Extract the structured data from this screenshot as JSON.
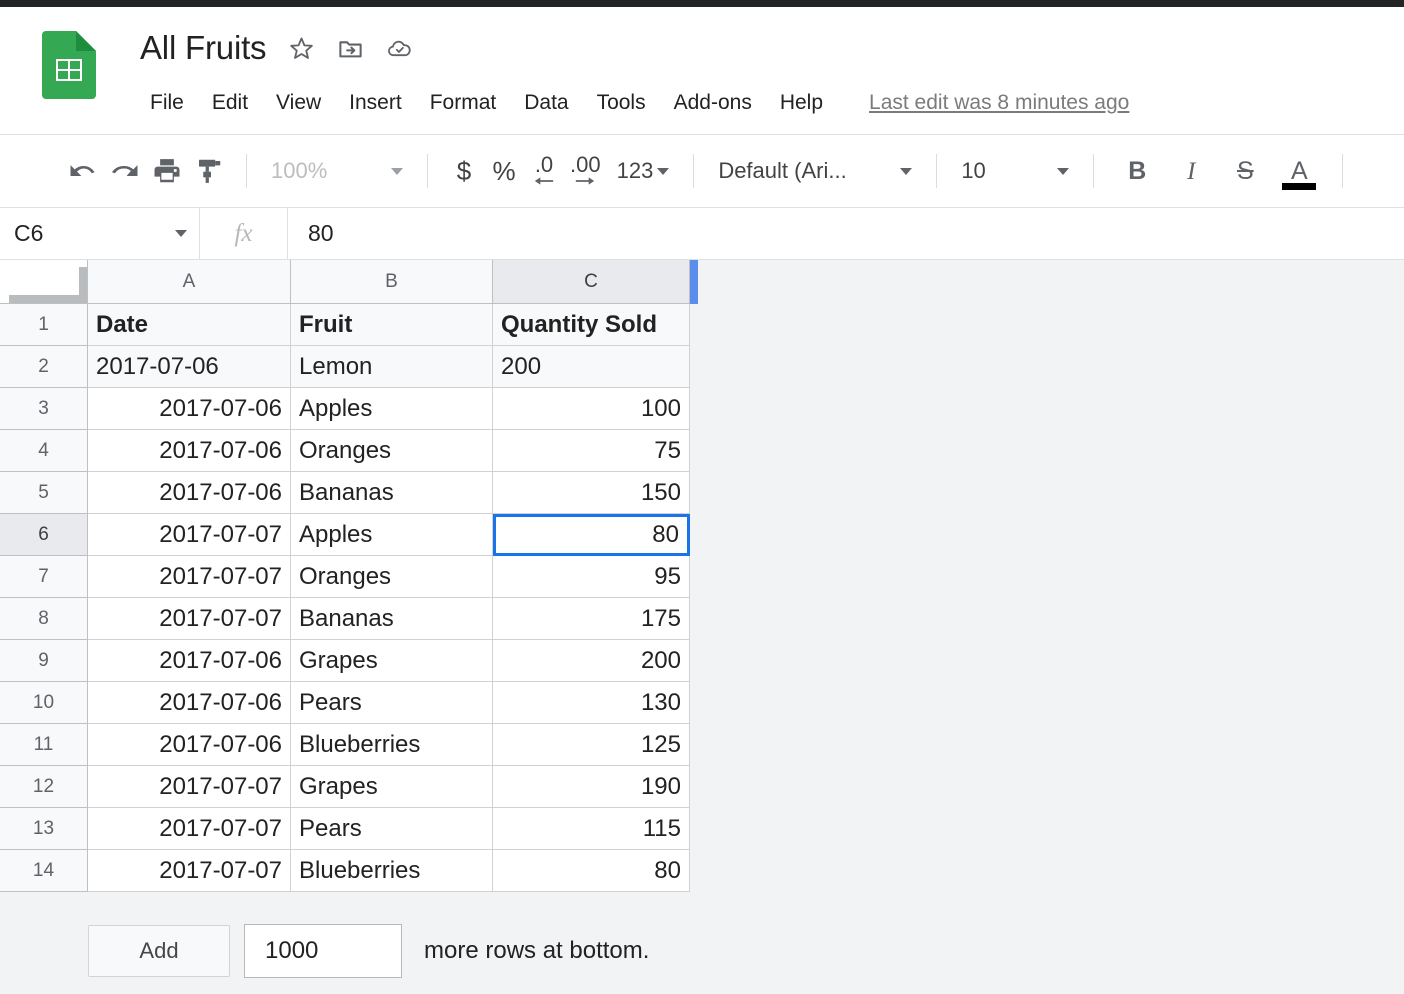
{
  "app": {
    "logo_icon": "sheets-logo-icon"
  },
  "header": {
    "doc_title": "All Fruits",
    "star_icon": "star-icon",
    "move_folder_icon": "move-to-folder-icon",
    "cloud_saved_icon": "cloud-saved-icon",
    "menus": [
      "File",
      "Edit",
      "View",
      "Insert",
      "Format",
      "Data",
      "Tools",
      "Add-ons",
      "Help"
    ],
    "last_edit": "Last edit was 8 minutes ago"
  },
  "toolbar": {
    "undo_icon": "undo-icon",
    "redo_icon": "redo-icon",
    "print_icon": "print-icon",
    "paint_format_icon": "paint-format-icon",
    "zoom_value": "100%",
    "currency_label": "$",
    "percent_label": "%",
    "decrease_decimal_label": ".0",
    "increase_decimal_label": ".00",
    "number_format_label": "123",
    "font_value": "Default (Ari...",
    "font_size_value": "10",
    "bold_label": "B",
    "italic_label": "I",
    "strikethrough_label": "S",
    "text_color_label": "A",
    "text_color_swatch": "#000000"
  },
  "formula_bar": {
    "name_box_value": "C6",
    "fx_label": "fx",
    "formula_value": "80"
  },
  "grid": {
    "selected_cell": "C6",
    "selection_color": "#1a73e8",
    "column_headers": [
      "A",
      "B",
      "C"
    ],
    "selected_column": "C",
    "selected_row": 6,
    "row_numbers": [
      1,
      2,
      3,
      4,
      5,
      6,
      7,
      8,
      9,
      10,
      11,
      12,
      13,
      14
    ],
    "rows": [
      {
        "n": 1,
        "a": "Date",
        "b": "Fruit",
        "c": "Quantity Sold",
        "style": "header"
      },
      {
        "n": 2,
        "a": "2017-07-06",
        "b": "Lemon",
        "c": "200",
        "style": "text"
      },
      {
        "n": 3,
        "a": "2017-07-06",
        "b": "Apples",
        "c": "100",
        "style": "numeric"
      },
      {
        "n": 4,
        "a": "2017-07-06",
        "b": "Oranges",
        "c": "75",
        "style": "numeric"
      },
      {
        "n": 5,
        "a": "2017-07-06",
        "b": "Bananas",
        "c": "150",
        "style": "numeric"
      },
      {
        "n": 6,
        "a": "2017-07-07",
        "b": "Apples",
        "c": "80",
        "style": "numeric"
      },
      {
        "n": 7,
        "a": "2017-07-07",
        "b": "Oranges",
        "c": "95",
        "style": "numeric"
      },
      {
        "n": 8,
        "a": "2017-07-07",
        "b": "Bananas",
        "c": "175",
        "style": "numeric"
      },
      {
        "n": 9,
        "a": "2017-07-06",
        "b": "Grapes",
        "c": "200",
        "style": "numeric"
      },
      {
        "n": 10,
        "a": "2017-07-06",
        "b": "Pears",
        "c": "130",
        "style": "numeric"
      },
      {
        "n": 11,
        "a": "2017-07-06",
        "b": "Blueberries",
        "c": "125",
        "style": "numeric"
      },
      {
        "n": 12,
        "a": "2017-07-07",
        "b": "Grapes",
        "c": "190",
        "style": "numeric"
      },
      {
        "n": 13,
        "a": "2017-07-07",
        "b": "Pears",
        "c": "115",
        "style": "numeric"
      },
      {
        "n": 14,
        "a": "2017-07-07",
        "b": "Blueberries",
        "c": "80",
        "style": "numeric"
      }
    ]
  },
  "footer": {
    "add_button_label": "Add",
    "row_count_value": "1000",
    "trailing_label": "more rows at bottom."
  }
}
